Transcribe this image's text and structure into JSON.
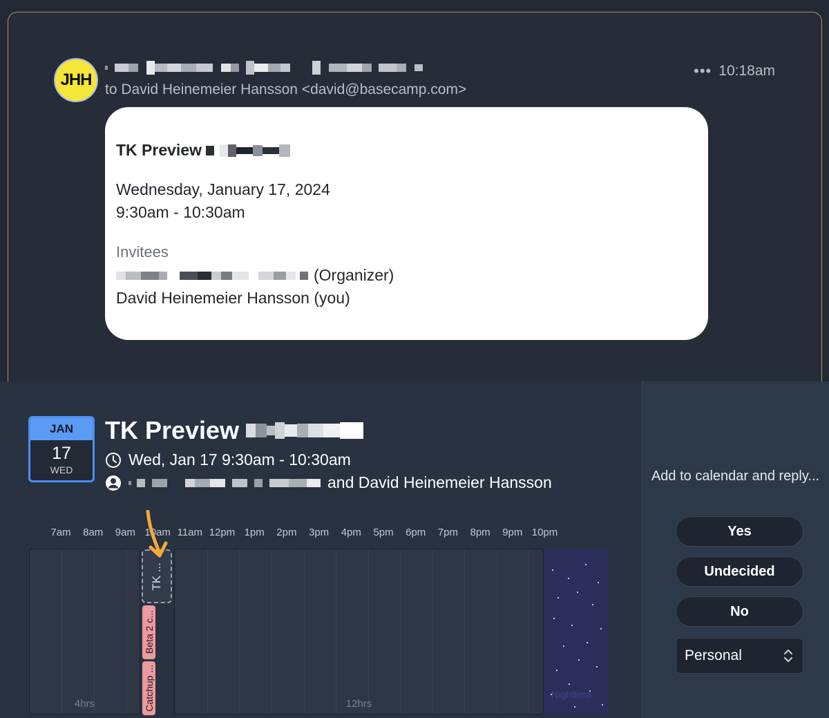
{
  "email": {
    "avatar_initials": "JHH",
    "recipient": "to David Heinemeier Hansson <david@basecamp.com>",
    "more_icon": "ellipsis-icon",
    "time": "10:18am"
  },
  "invite": {
    "title_prefix": "TK Preview",
    "date": "Wednesday, January 17, 2024",
    "time_range": "9:30am - 10:30am",
    "invitees_label": "Invitees",
    "organizer_suffix": "(Organizer)",
    "you_line": "David Heinemeier Hansson (you)"
  },
  "event": {
    "month": "JAN",
    "day": "17",
    "weekday": "WED",
    "title_prefix": "TK Preview",
    "when": "Wed, Jan 17 9:30am - 10:30am",
    "attendees_suffix": "and David Heinemeier Hansson"
  },
  "timeline": {
    "hours": [
      "7am",
      "8am",
      "9am",
      "10am",
      "11am",
      "12pm",
      "1pm",
      "2pm",
      "3pm",
      "4pm",
      "5pm",
      "6pm",
      "7pm",
      "8pm",
      "9pm",
      "10pm"
    ],
    "free_before": "4hrs",
    "free_after": "12hrs",
    "night_label": "Nighttime",
    "proposed_event": "TK ...",
    "events": [
      {
        "label": "Beta 2 c..."
      },
      {
        "label": "Catchup ..."
      }
    ]
  },
  "reply": {
    "prompt": "Add to calendar and reply...",
    "yes": "Yes",
    "undecided": "Undecided",
    "no": "No",
    "calendar": "Personal"
  },
  "colors": {
    "accent": "#5b9bf3",
    "avatar_bg": "#f5e63a",
    "event_pink": "#eb9a9d",
    "arrow": "#f2a93b",
    "night": "#2d2e5c"
  }
}
